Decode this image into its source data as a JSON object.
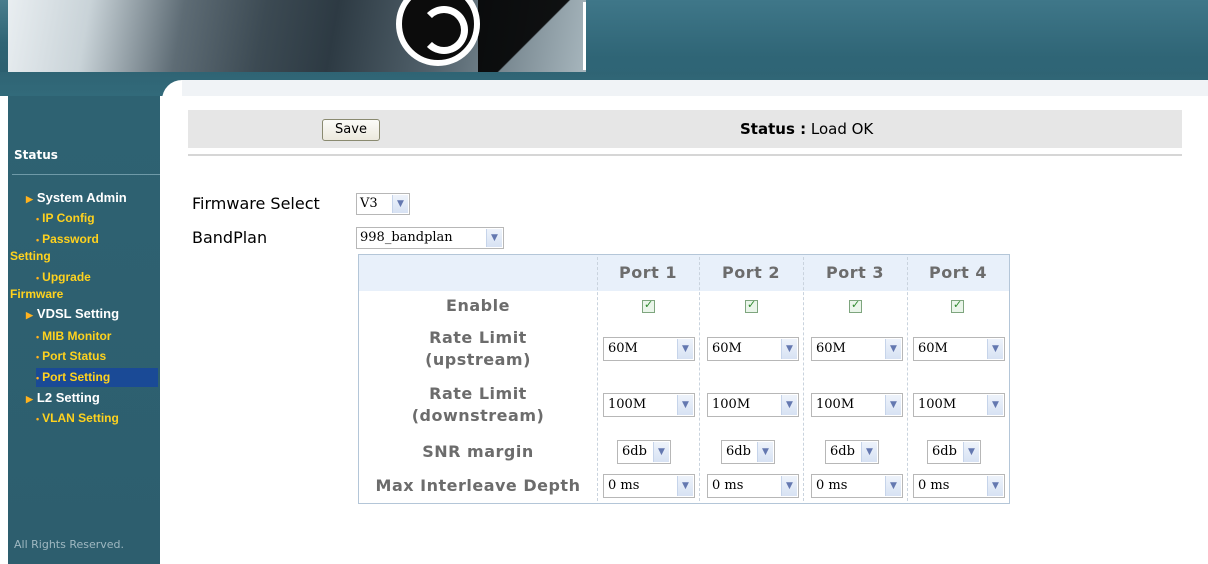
{
  "sidebar": {
    "title": "Status",
    "items": [
      {
        "label": "System Admin",
        "type": "section"
      },
      {
        "label": "IP Config",
        "type": "sub"
      },
      {
        "label": "Password",
        "type": "sub"
      },
      {
        "label": "Setting",
        "type": "cont"
      },
      {
        "label": "Upgrade",
        "type": "sub"
      },
      {
        "label": "Firmware",
        "type": "cont"
      },
      {
        "label": "VDSL Setting",
        "type": "section"
      },
      {
        "label": "MIB Monitor",
        "type": "sub"
      },
      {
        "label": "Port Status",
        "type": "sub"
      },
      {
        "label": "Port Setting",
        "type": "sub",
        "active": true
      },
      {
        "label": "L2 Setting",
        "type": "section"
      },
      {
        "label": "VLAN Setting",
        "type": "sub"
      }
    ],
    "footer": "All Rights Reserved."
  },
  "toolbar": {
    "save_label": "Save",
    "status_key": "Status :",
    "status_value": "Load OK"
  },
  "form": {
    "firmware_label": "Firmware Select",
    "firmware_value": "V3",
    "bandplan_label": "BandPlan",
    "bandplan_value": "998_bandplan"
  },
  "table": {
    "headers": [
      "Port 1",
      "Port 2",
      "Port 3",
      "Port 4"
    ],
    "rows": {
      "enable": {
        "label": "Enable",
        "values": [
          true,
          true,
          true,
          true
        ]
      },
      "rate_up": {
        "label_line1": "Rate Limit",
        "label_line2": "(upstream)",
        "values": [
          "60M",
          "60M",
          "60M",
          "60M"
        ]
      },
      "rate_down": {
        "label_line1": "Rate Limit",
        "label_line2": "(downstream)",
        "values": [
          "100M",
          "100M",
          "100M",
          "100M"
        ]
      },
      "snr": {
        "label": "SNR margin",
        "values": [
          "6db",
          "6db",
          "6db",
          "6db"
        ]
      },
      "interleave": {
        "label": "Max Interleave Depth",
        "values": [
          "0 ms",
          "0 ms",
          "0 ms",
          "0 ms"
        ]
      }
    }
  },
  "icons": {
    "dropdown": "chevron-down-icon",
    "checkbox": "checkbox-checked-icon",
    "section": "triangle-bullet-icon",
    "sub": "dot-bullet-icon"
  },
  "colors": {
    "sidebar_bg": "#2e6272",
    "sidebar_sub_text": "#ffd21e",
    "active_item_bg": "#1a4a96",
    "table_header_bg": "#e8f0fa"
  }
}
